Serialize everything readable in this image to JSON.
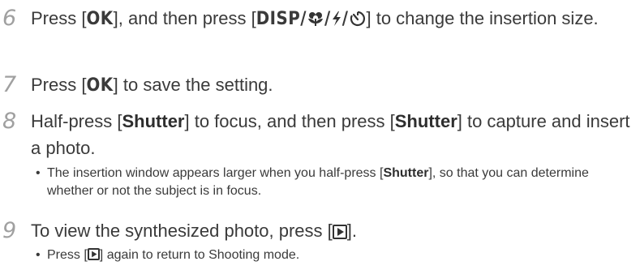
{
  "steps": [
    {
      "number": "6",
      "text_before_ok": "Press [",
      "ok_key": "OK",
      "text_mid": "], and then press [",
      "disp_key": "DISP/",
      "text_after": "] to change the insertion size.",
      "icons": [
        "macro-flower-icon",
        "flash-icon",
        "self-timer-icon"
      ]
    },
    {
      "number": "7",
      "text_before": "Press [",
      "ok_key": "OK",
      "text_after": "] to save the setting."
    },
    {
      "number": "8",
      "part1": "Half-press [",
      "shutter1": "Shutter",
      "part2": "] to focus, and then press [",
      "shutter2": "Shutter",
      "part3": "] to capture and insert a photo.",
      "bullet": {
        "part1": "The insertion window appears larger when you half-press [",
        "shutter": "Shutter",
        "part2": "], so that you can determine whether or not the subject is in focus."
      }
    },
    {
      "number": "9",
      "part1": "To view the synthesized photo, press [",
      "part2": "].",
      "icon": "playback-icon",
      "bullet": {
        "part1": "Press [",
        "part2": "] again to return to Shooting mode."
      }
    }
  ]
}
